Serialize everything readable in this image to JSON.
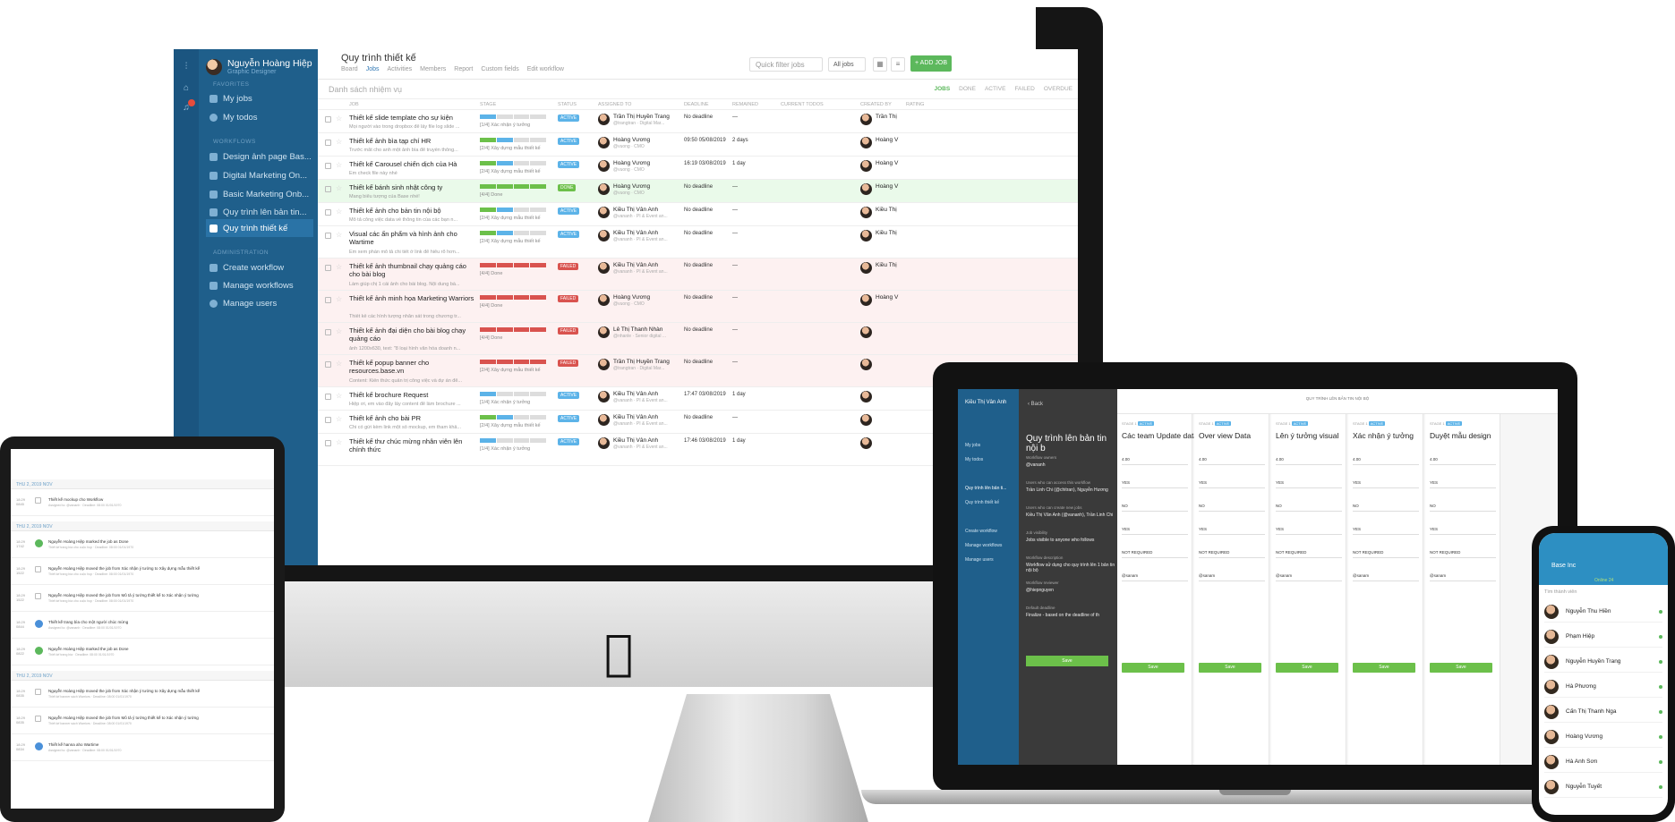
{
  "imac": {
    "user_name": "Nguyễn Hoàng Hiệp",
    "user_sub": "Graphic Designer",
    "sections": {
      "favorites": "FAVORITES",
      "workflows": "WORKFLOWS",
      "administration": "ADMINISTRATION"
    },
    "menu": {
      "my_jobs": "My jobs",
      "my_todos": "My todos"
    },
    "workflows": [
      "Design ảnh page Bas...",
      "Digital Marketing On...",
      "Basic Marketing Onb...",
      "Quy trình lên bản tin...",
      "Quy trình thiết kế"
    ],
    "admin": [
      "Create workflow",
      "Manage workflows",
      "Manage users"
    ],
    "page_title": "Quy trình thiết kế",
    "tabs": [
      "Board",
      "Jobs",
      "Activities",
      "Members",
      "Report",
      "Custom fields",
      "Edit workflow"
    ],
    "quick_filter": "Quick filter jobs",
    "all_jobs": "All jobs",
    "add_job": "+ ADD JOB",
    "list_title": "Danh sách nhiệm vụ",
    "filters": [
      "JOBS",
      "DONE",
      "ACTIVE",
      "FAILED",
      "OVERDUE"
    ],
    "columns": [
      "JOB",
      "STAGE",
      "STATUS",
      "ASSIGNED TO",
      "DEADLINE",
      "REMAINED",
      "CURRENT TODOS",
      "CREATED BY",
      "RATING"
    ],
    "rows": [
      {
        "title": "Thiết kế slide template cho sự kiện",
        "desc": "Mọi người vào trong dropbox để lấy file log slide ...",
        "stage": "[1/4] Xác nhận ý tưởng",
        "status": "ACTIVE",
        "assignee": "Trần Thị Huyền Trang",
        "assignee_sub": "@trangtran · Digital Mar...",
        "deadline": "No deadline",
        "remained": "—",
        "creator": "Trần Thị",
        "kind": "active",
        "fill": 1
      },
      {
        "title": "Thiết kế ảnh bìa tạp chí HR",
        "desc": "Trước mắt cho anh một ảnh bìa để truyền thông...",
        "stage": "[2/4] Xây dựng mẫu thiết kế",
        "status": "ACTIVE",
        "assignee": "Hoàng Vương",
        "assignee_sub": "@vuong · CMO",
        "deadline": "09:50 05/08/2019",
        "remained": "2 days",
        "creator": "Hoàng V",
        "kind": "active",
        "fill": 2
      },
      {
        "title": "Thiết kế Carousel chiến dịch của Hà",
        "desc": "Em check file này nhé",
        "stage": "[2/4] Xây dựng mẫu thiết kế",
        "status": "ACTIVE",
        "assignee": "Hoàng Vương",
        "assignee_sub": "@vuong · CMO",
        "deadline": "16:19 03/08/2019",
        "remained": "1 day",
        "creator": "Hoàng V",
        "kind": "active",
        "fill": 2
      },
      {
        "title": "Thiết kế bánh sinh nhật công ty",
        "desc": "Mang biểu tượng của Base nhé!",
        "stage": "[4/4] Done",
        "status": "DONE",
        "assignee": "Hoàng Vương",
        "assignee_sub": "@vuong · CMO",
        "deadline": "No deadline",
        "remained": "—",
        "creator": "Hoàng V",
        "kind": "done",
        "fill": 4
      },
      {
        "title": "Thiết kế ảnh cho bản tin nội bộ",
        "desc": "Mô tả công việc data về thông tin của các bạn n...",
        "stage": "[2/4] Xây dựng mẫu thiết kế",
        "status": "ACTIVE",
        "assignee": "Kiều Thị Vân Anh",
        "assignee_sub": "@vananh · PI & Event an...",
        "deadline": "No deadline",
        "remained": "—",
        "creator": "Kiều Thị",
        "kind": "active",
        "fill": 2
      },
      {
        "title": "Visual các ấn phẩm và hình ảnh cho Wartime",
        "desc": "Em xem phần mô tả chi tiết ở link để hiểu rõ hơn...",
        "stage": "[2/4] Xây dựng mẫu thiết kế",
        "status": "ACTIVE",
        "assignee": "Kiều Thị Vân Anh",
        "assignee_sub": "@vananh · PI & Event an...",
        "deadline": "No deadline",
        "remained": "—",
        "creator": "Kiều Thị",
        "kind": "active tall",
        "fill": 2
      },
      {
        "title": "Thiết kế ảnh thumbnail chạy quảng cáo cho bài blog",
        "desc": "Làm giúp chị 1 cái ảnh cho bài blog. Nội dung bà...",
        "stage": "[4/4] Done",
        "status": "FAILED",
        "assignee": "Kiều Thị Vân Anh",
        "assignee_sub": "@vananh · PI & Event an...",
        "deadline": "No deadline",
        "remained": "—",
        "creator": "Kiều Thị",
        "kind": "failed tall",
        "fill": 4
      },
      {
        "title": "Thiết kế ảnh minh họa Marketing Warriors",
        "desc": "Thiết kế các hình tượng nhân sát trong chương tr...",
        "stage": "[4/4] Done",
        "status": "FAILED",
        "assignee": "Hoàng Vương",
        "assignee_sub": "@vuong · CMO",
        "deadline": "No deadline",
        "remained": "—",
        "creator": "Hoàng V",
        "kind": "failed tall",
        "fill": 4
      },
      {
        "title": "Thiết kế ảnh đại diện cho bài blog chạy quảng cáo",
        "desc": "ảnh 1200x630, text: \"8 loại hình văn hóa doanh n...",
        "stage": "[4/4] Done",
        "status": "FAILED",
        "assignee": "Lê Thị Thanh Nhàn",
        "assignee_sub": "@nhanle · Senior digital ...",
        "deadline": "No deadline",
        "remained": "—",
        "creator": "",
        "kind": "failed tall",
        "fill": 4
      },
      {
        "title": "Thiết kế popup banner cho resources.base.vn",
        "desc": "Content: Kiến thức quản trị công việc và dự án để...",
        "stage": "[2/4] Xây dựng mẫu thiết kế",
        "status": "FAILED",
        "assignee": "Trần Thị Huyền Trang",
        "assignee_sub": "@trangtran · Digital Mar...",
        "deadline": "No deadline",
        "remained": "—",
        "creator": "",
        "kind": "failed tall",
        "fill": 4
      },
      {
        "title": "Thiết kế brochure Request",
        "desc": "Hiệp ơi, em vào đây lấy content để làm brochure ...",
        "stage": "[1/4] Xác nhận ý tưởng",
        "status": "ACTIVE",
        "assignee": "Kiều Thị Vân Anh",
        "assignee_sub": "@vananh · PI & Event an...",
        "deadline": "17:47 03/08/2019",
        "remained": "1 day",
        "creator": "",
        "kind": "active",
        "fill": 1
      },
      {
        "title": "Thiết kế ảnh cho bài PR",
        "desc": "Chi có gửi kèm link một số mockup, em tham khả...",
        "stage": "[2/4] Xây dựng mẫu thiết kế",
        "status": "ACTIVE",
        "assignee": "Kiều Thị Vân Anh",
        "assignee_sub": "@vananh · PI & Event an...",
        "deadline": "No deadline",
        "remained": "—",
        "creator": "",
        "kind": "active",
        "fill": 2
      },
      {
        "title": "Thiết kế thư chúc mừng nhân viên lên chính thức",
        "desc": "",
        "stage": "[1/4] Xác nhận ý tưởng",
        "status": "ACTIVE",
        "assignee": "Kiều Thị Vân Anh",
        "assignee_sub": "@vananh · PI & Event an...",
        "deadline": "17:46 03/08/2019",
        "remained": "1 day",
        "creator": "",
        "kind": "active tall",
        "fill": 1
      }
    ]
  },
  "tablet": {
    "groups": [
      {
        "header": "THU 2, 2019 NOV",
        "items": [
          {
            "time": "18:29\n0845",
            "text": "Thiết kế mockup cho Workflow",
            "sub": "Assigned to: @vananh · Deadline: 08:00 01/01/1970",
            "icon": "line"
          }
        ]
      },
      {
        "header": "THU 2, 2019 NOV",
        "items": [
          {
            "time": "18:29\n1742",
            "text": "Nguyễn Hoàng Hiệp marked the job as Done",
            "sub": "Thiết kế trang bìa cho cuộc họp · Deadline: 08:00 01/01/1970",
            "icon": "green"
          },
          {
            "time": "18:29\n1522",
            "text": "Nguyễn Hoàng Hiệp moved the job from Xác nhận ý tưởng to Xây dựng mẫu thiết kế",
            "sub": "Thiết kế trang bìa cho cuộc họp · Deadline: 08:00 01/01/1970",
            "icon": "line"
          },
          {
            "time": "18:29\n1522",
            "text": "Nguyễn Hoàng Hiệp moved the job from Mô tả ý tưởng thiết kế to Xác nhận ý tưởng",
            "sub": "Thiết kế trang bìa cho cuộc họp · Deadline: 08:00 01/01/1970",
            "icon": "line"
          },
          {
            "time": "18:29\n0844",
            "text": "Thiết kế trang bìa cho một người chúc mừng",
            "sub": "Assigned to: @vananh · Deadline: 08:00 01/01/1970",
            "icon": "blue"
          },
          {
            "time": "18:29\n0822",
            "text": "Nguyễn Hoàng Hiệp marked the job as Done",
            "sub": "Thiết kế trang bìa · Deadline: 08:00 01/01/1970",
            "icon": "green"
          }
        ]
      },
      {
        "header": "THU 2, 2019 NOV",
        "items": [
          {
            "time": "18:29\n0835",
            "text": "Nguyễn Hoàng Hiệp moved the job from Xác nhận ý tưởng to Xây dựng mẫu thiết kế",
            "sub": "Thiết kế banner sách Warriors · Deadline: 08:00 01/01/1970",
            "icon": "line"
          },
          {
            "time": "18:29\n0835",
            "text": "Nguyễn Hoàng Hiệp moved the job from Mô tả ý tưởng thiết kế to Xác nhận ý tưởng",
            "sub": "Thiết kế banner sách Warriors · Deadline: 08:00 01/01/1970",
            "icon": "line"
          },
          {
            "time": "18:29\n0834",
            "text": "Thiết kế hanna aho Wartime",
            "sub": "Assigned to: @vananh · Deadline: 08:00 01/01/1970",
            "icon": "blue"
          }
        ]
      }
    ]
  },
  "laptop": {
    "rail_user": "Kiều Thị Vân Anh",
    "rail_items": [
      "My jobs",
      "My todos",
      "Quy trình lên bản ti...",
      "Quy trình thiết kế",
      "Create workflow",
      "Manage workflows",
      "Manage users"
    ],
    "back": "‹  Back",
    "panel_title": "Quy trình lên bản tin nội b",
    "panel_fields": [
      {
        "label": "Workflow owners",
        "value": "@vananh"
      },
      {
        "label": "Users who can access this workflow",
        "value": "Trần Linh Chi (@chitran), Nguyễn Hương"
      },
      {
        "label": "Users who can create new jobs",
        "value": "Kiều Thị Vân Anh (@vananh), Trần Linh Chi"
      },
      {
        "label": "Job visibility",
        "value": "Jobs visible to anyone who follows"
      },
      {
        "label": "Workflow description",
        "value": "Workflow sử dụng cho quy trình lên 1 bản tin nội bộ"
      },
      {
        "label": "Workflow reviewer",
        "value": "@hiepnguyen"
      },
      {
        "label": "Default deadline",
        "value": "Finalize - based on the deadline of th"
      }
    ],
    "panel_save": "Save",
    "header": "QUY TRÌNH LÊN BẢN TIN NỘI BỘ",
    "stage_tag": "STAGE 1",
    "stage_badge": "ACTIVE",
    "columns": [
      "Các team Update data",
      "Over view Data",
      "Lên ý tưởng visual",
      "Xác nhận ý tưởng",
      "Duyệt mẫu design"
    ],
    "column_lines": [
      "4.00",
      "YES",
      "NO",
      "YES",
      "NOT REQUIRED",
      "@sanam"
    ],
    "save": "Save"
  },
  "phone": {
    "title": "Base Inc",
    "online": "Online  24",
    "search": "Tìm thành viên",
    "members": [
      "Nguyễn Thu Hiền",
      "Phạm Hiệp",
      "Nguyễn Huyền Trang",
      "Hà Phương",
      "Cấn Thị Thanh Nga",
      "Hoàng Vương",
      "Hà Anh Sơn",
      "Nguyễn Tuyết"
    ]
  },
  "colors": {
    "sidebar": "#1f5f8b",
    "accent_green": "#5cb85c",
    "active_blue": "#5cb3e8",
    "failed_red": "#d9534f"
  }
}
